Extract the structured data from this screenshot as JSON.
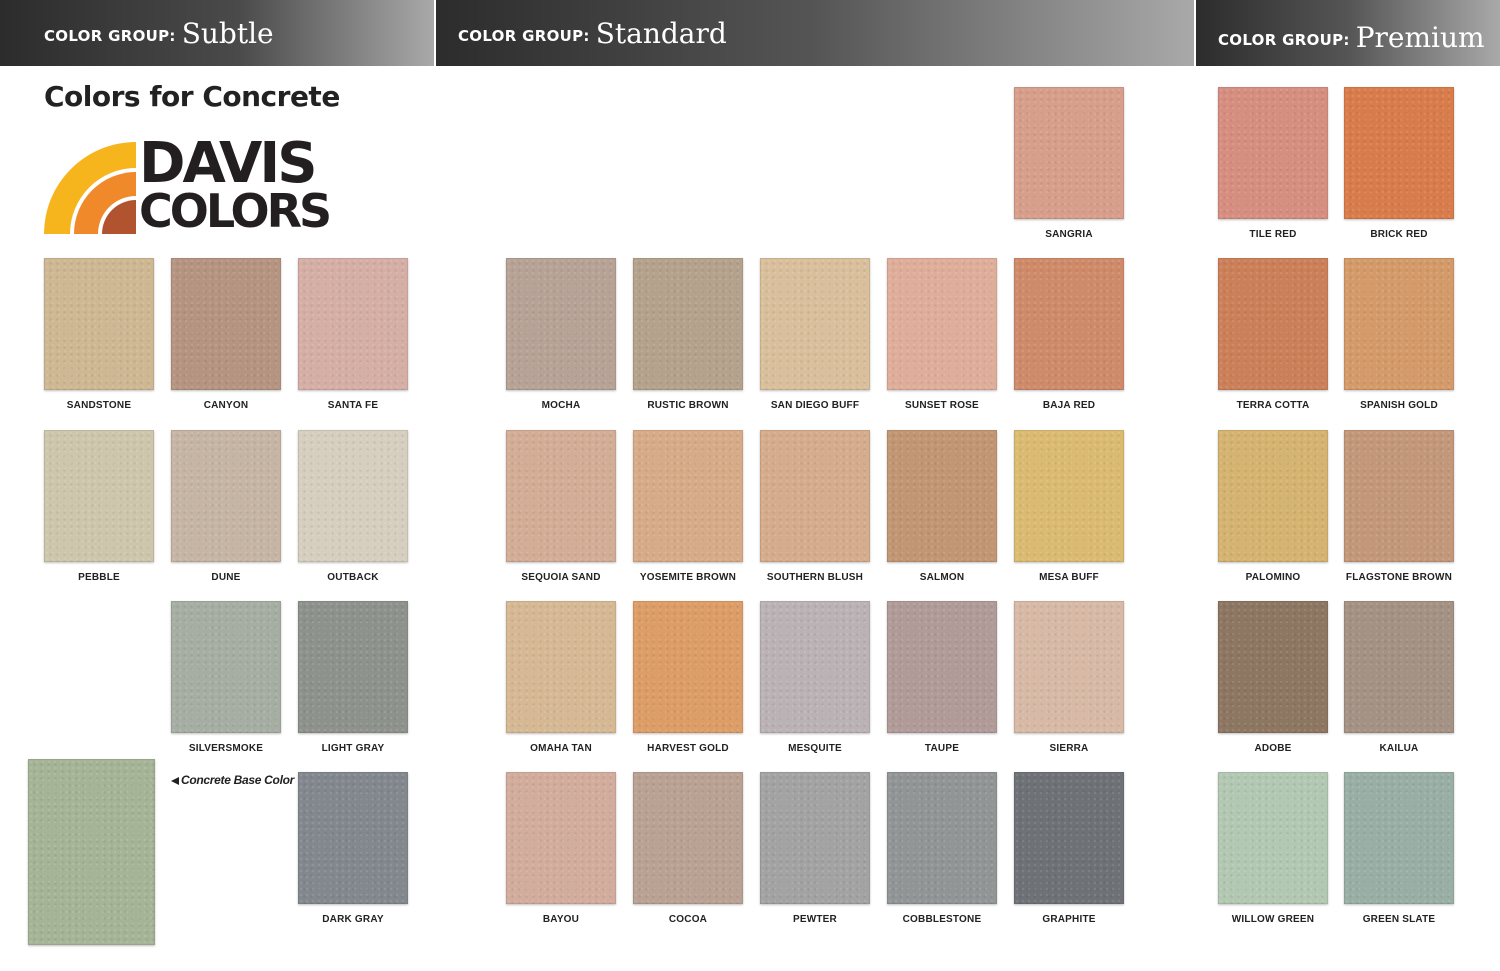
{
  "header": {
    "prefix": "COLOR GROUP:",
    "groups": [
      {
        "name": "Subtle"
      },
      {
        "name": "Standard"
      },
      {
        "name": "Premium"
      }
    ]
  },
  "page_title": "Colors for Concrete",
  "logo": {
    "line1": "DAVIS",
    "line2": "COLORS",
    "colors": [
      "#f7b51d",
      "#f0892a",
      "#b2532f"
    ]
  },
  "base_color": {
    "caption": "Concrete Base Color",
    "color": "#a5b497"
  },
  "swatches": {
    "subtle": [
      {
        "name": "SANDSTONE",
        "color": "#cdb893"
      },
      {
        "name": "CANYON",
        "color": "#b59481"
      },
      {
        "name": "SANTA FE",
        "color": "#d5aea5"
      },
      {
        "name": "PEBBLE",
        "color": "#cec6ac"
      },
      {
        "name": "DUNE",
        "color": "#c6b5a4"
      },
      {
        "name": "OUTBACK",
        "color": "#d6cebf"
      },
      {
        "name": "SILVERSMOKE",
        "color": "#a6aea4"
      },
      {
        "name": "LIGHT GRAY",
        "color": "#8e928c"
      },
      {
        "name": "DARK GRAY",
        "color": "#83888f"
      }
    ],
    "standard": [
      {
        "name": "SANGRIA",
        "color": "#d79e8b"
      },
      {
        "name": "MOCHA",
        "color": "#b7a296"
      },
      {
        "name": "RUSTIC BROWN",
        "color": "#b4a28c"
      },
      {
        "name": "SAN DIEGO BUFF",
        "color": "#d9bf9c"
      },
      {
        "name": "SUNSET ROSE",
        "color": "#dfae9b"
      },
      {
        "name": "BAJA RED",
        "color": "#cf8b69"
      },
      {
        "name": "SEQUOIA SAND",
        "color": "#d3ad95"
      },
      {
        "name": "YOSEMITE BROWN",
        "color": "#d7ab88"
      },
      {
        "name": "SOUTHERN BLUSH",
        "color": "#d5ac8c"
      },
      {
        "name": "SALMON",
        "color": "#c19673"
      },
      {
        "name": "MESA BUFF",
        "color": "#dbbb72"
      },
      {
        "name": "OMAHA TAN",
        "color": "#d6b994"
      },
      {
        "name": "HARVEST GOLD",
        "color": "#dd9d67"
      },
      {
        "name": "MESQUITE",
        "color": "#bbb2b6"
      },
      {
        "name": "TAUPE",
        "color": "#b19b99"
      },
      {
        "name": "SIERRA",
        "color": "#d7b9a6"
      },
      {
        "name": "BAYOU",
        "color": "#d2ac9c"
      },
      {
        "name": "COCOA",
        "color": "#b9a193"
      },
      {
        "name": "PEWTER",
        "color": "#a3a3a4"
      },
      {
        "name": "COBBLESTONE",
        "color": "#929596"
      },
      {
        "name": "GRAPHITE",
        "color": "#6e7176"
      }
    ],
    "premium": [
      {
        "name": "TILE RED",
        "color": "#d68e80"
      },
      {
        "name": "BRICK RED",
        "color": "#d97c4b"
      },
      {
        "name": "TERRA COTTA",
        "color": "#cb8059"
      },
      {
        "name": "SPANISH GOLD",
        "color": "#d49a69"
      },
      {
        "name": "PALOMINO",
        "color": "#d5b370"
      },
      {
        "name": "FLAGSTONE BROWN",
        "color": "#c3987a"
      },
      {
        "name": "ADOBE",
        "color": "#8d7662"
      },
      {
        "name": "KAILUA",
        "color": "#a49284"
      },
      {
        "name": "WILLOW GREEN",
        "color": "#b2c8b2"
      },
      {
        "name": "GREEN SLATE",
        "color": "#99afa6"
      }
    ]
  }
}
